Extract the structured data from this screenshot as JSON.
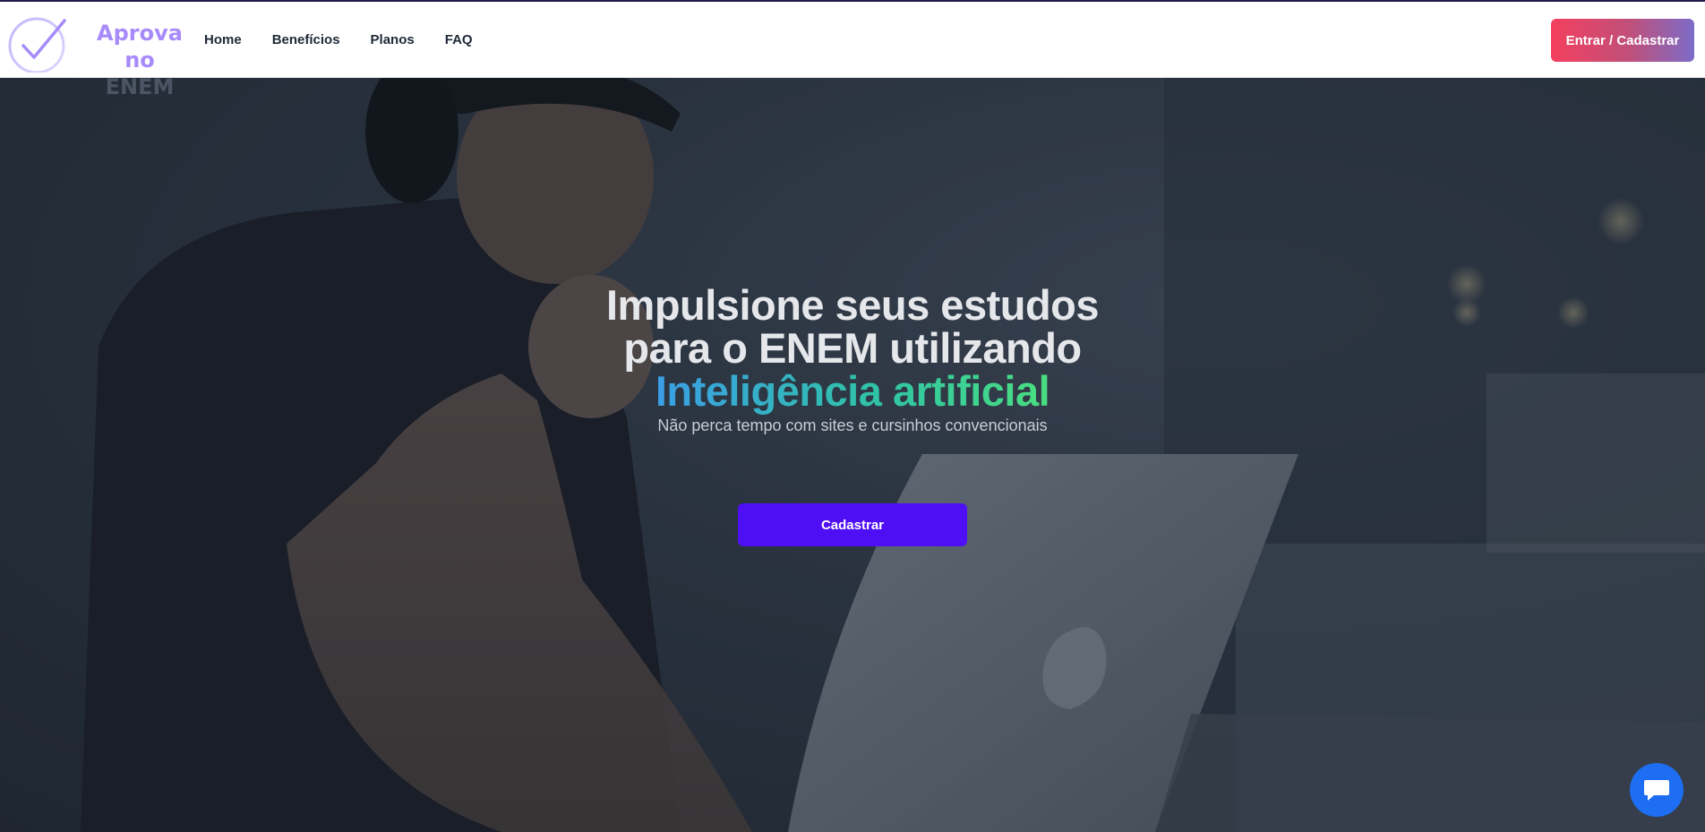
{
  "brand": {
    "line1": "Aprova no",
    "line2": "ENEM",
    "colors": {
      "accent": "#a78bfa",
      "secondary": "#4b5563"
    }
  },
  "nav": {
    "items": [
      {
        "label": "Home"
      },
      {
        "label": "Benefícios"
      },
      {
        "label": "Planos"
      },
      {
        "label": "FAQ"
      }
    ]
  },
  "header": {
    "cta_label": "Entrar / Cadastrar"
  },
  "hero": {
    "headline_line1": "Impulsione seus estudos",
    "headline_line2": "para o ENEM utilizando",
    "headline_highlight": "Inteligência artificial",
    "subtitle": "Não perca tempo com sites e cursinhos convencionais",
    "cta_label": "Cadastrar",
    "colors": {
      "cta": "#4f0ff5",
      "highlight_start": "#3b9ee6",
      "highlight_end": "#4ade80"
    }
  },
  "chat": {
    "icon": "chat-bubble-icon",
    "color": "#1d6ef2"
  }
}
